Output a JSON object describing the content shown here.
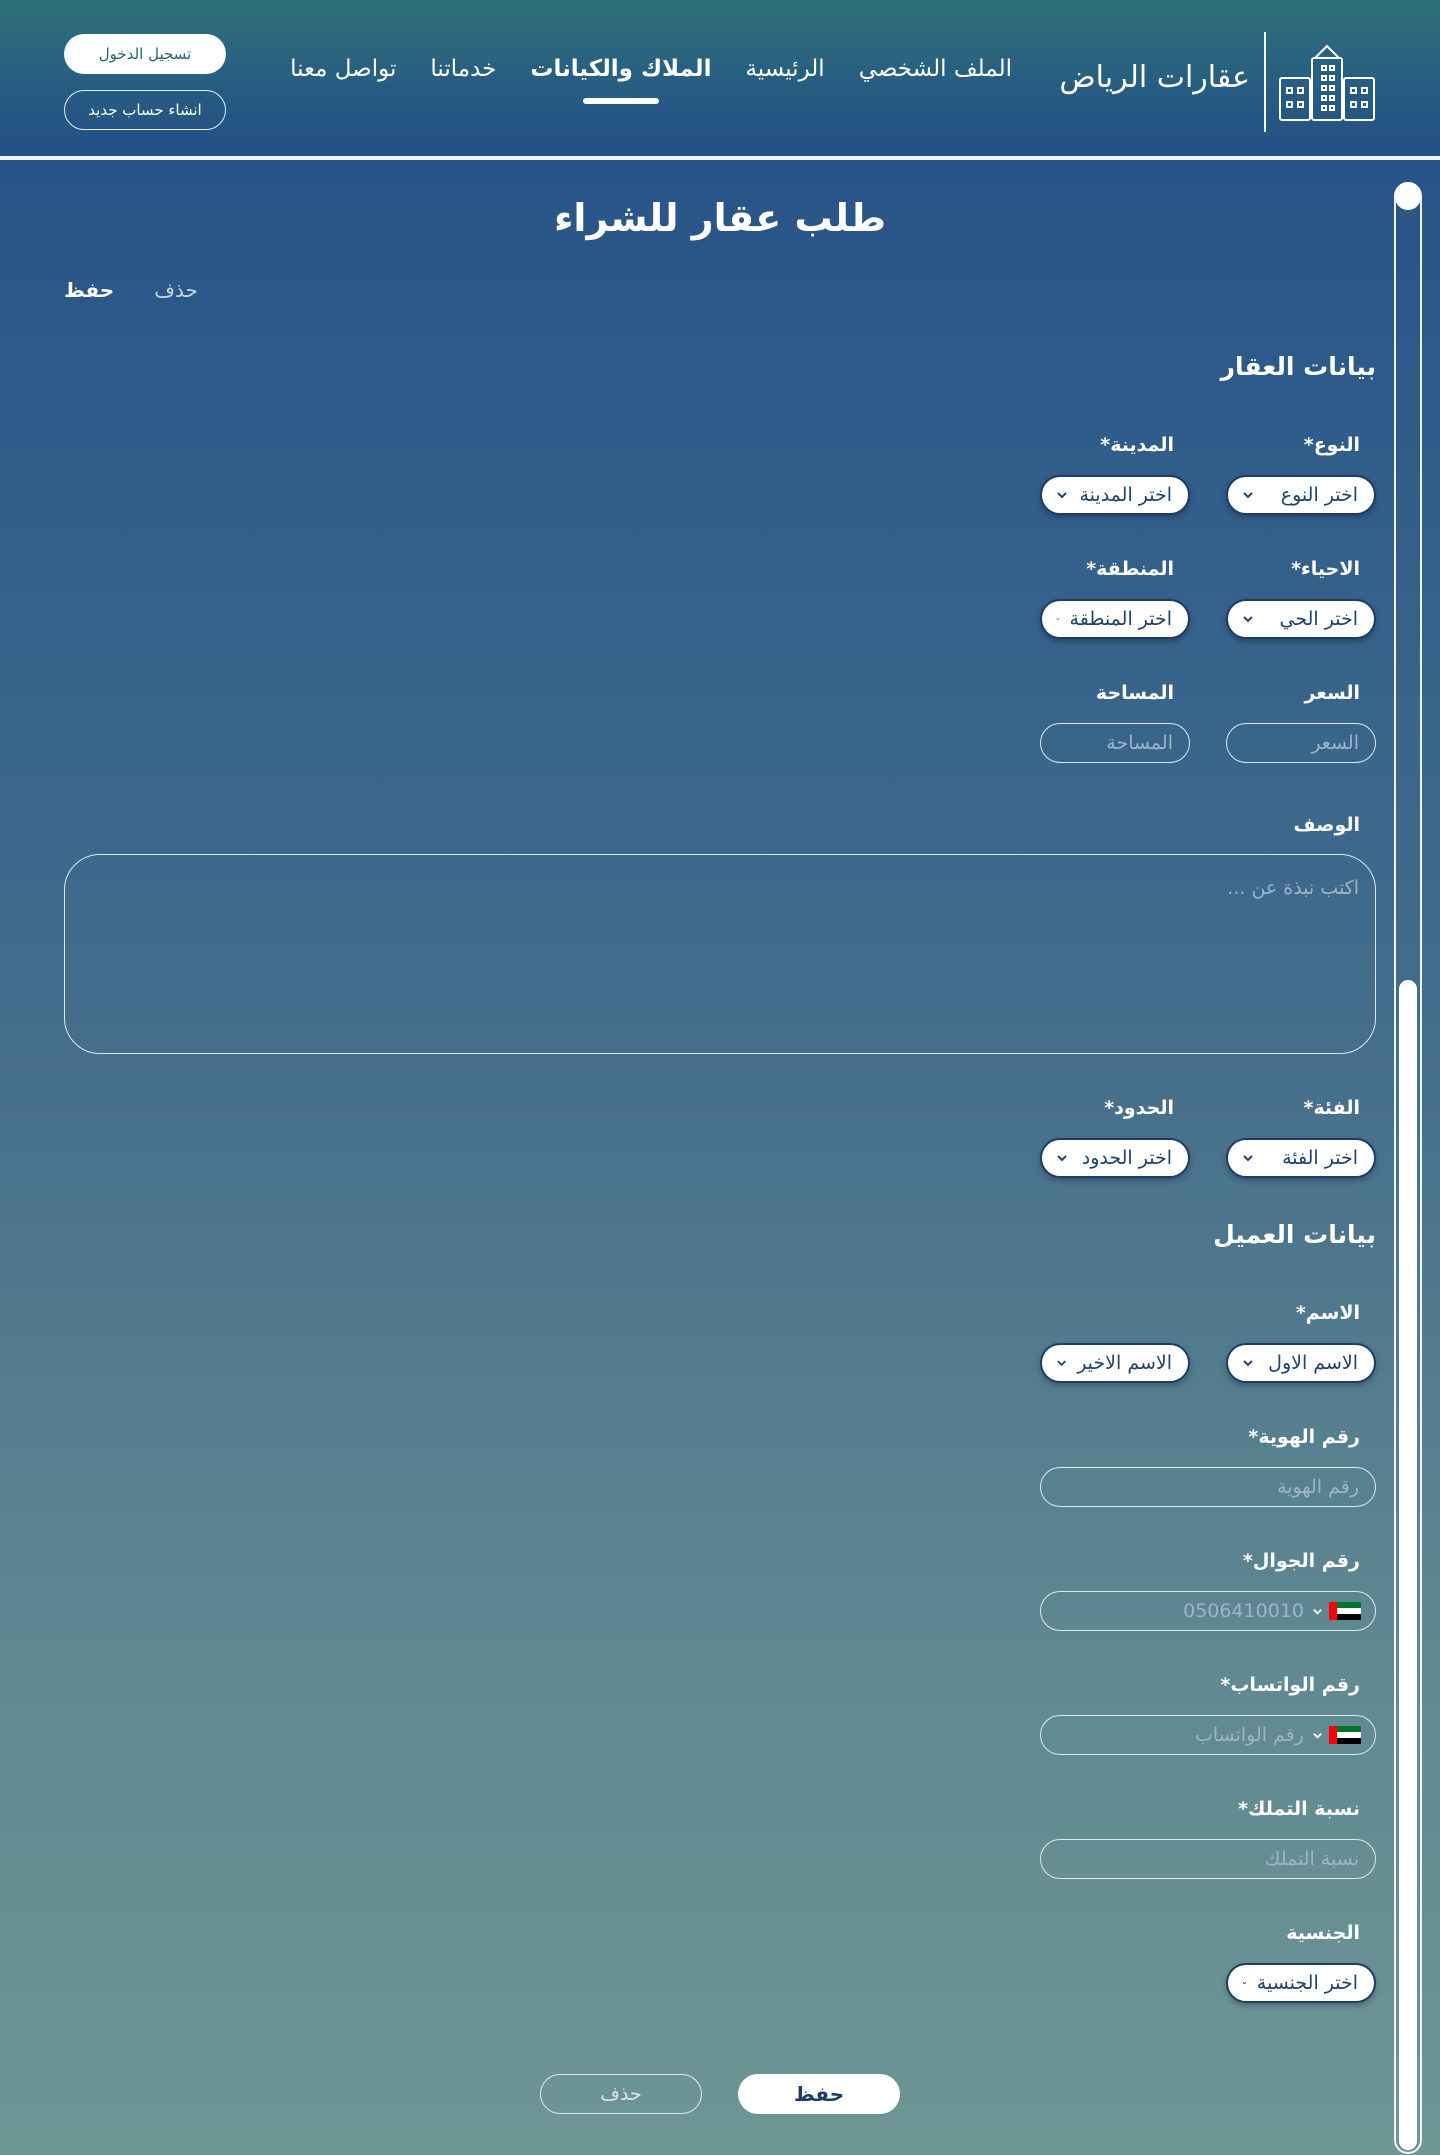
{
  "header": {
    "brand": "عقارات الرياض",
    "nav": [
      {
        "label": "الملف الشخصي",
        "active": false
      },
      {
        "label": "الرئيسية",
        "active": false
      },
      {
        "label": "الملاك والكيانات",
        "active": true
      },
      {
        "label": "خدماتنا",
        "active": false
      },
      {
        "label": "تواصل معنا",
        "active": false
      }
    ],
    "login": "تسجيل الدخول",
    "register": "انشاء حساب جديد"
  },
  "page": {
    "title": "طلب عقار للشراء",
    "save": "حفظ",
    "delete": "حذف"
  },
  "property": {
    "section_title": "بيانات العقار",
    "type_label": "النوع*",
    "type_value": "اختر النوع",
    "city_label": "المدينة*",
    "city_value": "اختر المدينة",
    "district_label": "الاحياء*",
    "district_value": "اختر الحي",
    "region_label": "المنطقة*",
    "region_value": "اختر المنطقة",
    "price_label": "السعر",
    "price_placeholder": "السعر",
    "area_label": "المساحة",
    "area_placeholder": "المساحة",
    "description_label": "الوصف",
    "description_placeholder": "اكتب نبذة عن ...",
    "category_label": "الفئة*",
    "category_value": "اختر الفئة",
    "borders_label": "الحدود*",
    "borders_value": "اختر الحدود"
  },
  "client": {
    "section_title": "بيانات العميل",
    "name_label": "الاسم*",
    "first_name": "الاسم الاول",
    "last_name": "الاسم الاخير",
    "id_label": "رقم الهوية*",
    "id_placeholder": "رقم الهوية",
    "mobile_label": "رقم الجوال*",
    "mobile_placeholder": "0506410010",
    "whatsapp_label": "رقم الواتساب*",
    "whatsapp_placeholder": "رقم الواتساب",
    "ownership_label": "نسبة التملك*",
    "ownership_placeholder": "نسبة التملك",
    "nationality_label": "الجنسية",
    "nationality_value": "اختر الجنسية"
  },
  "colors": {
    "accent": "#1d3c66",
    "header_top": "#2e7178",
    "header_bottom": "#234f86"
  },
  "icons": {
    "logo": "buildings-icon",
    "chevron": "chevron-down-icon",
    "flag": "uae-flag-icon"
  }
}
